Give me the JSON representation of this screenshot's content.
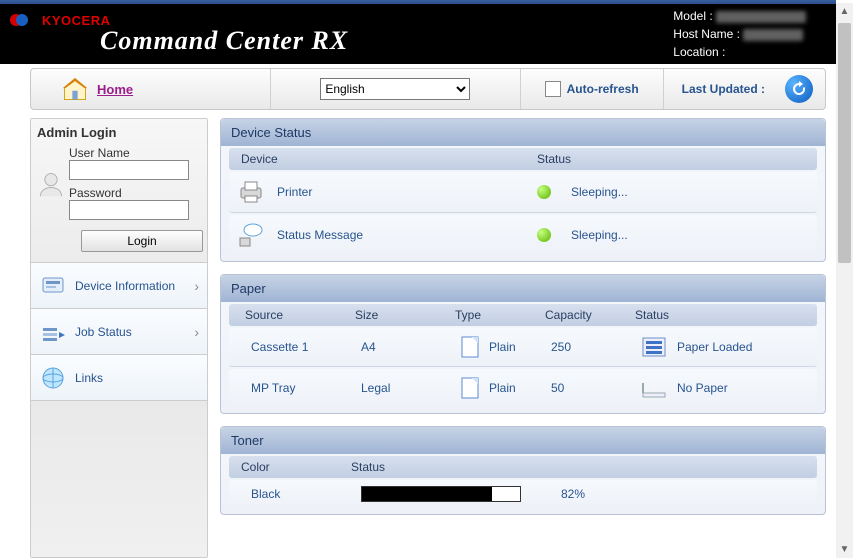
{
  "brand": {
    "vendor": "KYOCERA",
    "product": "Command Center",
    "suffix": "RX"
  },
  "host": {
    "model_label": "Model :",
    "model_value": "",
    "host_label": "Host Name :",
    "host_value": "",
    "location_label": "Location :"
  },
  "toolbar": {
    "home_label": "Home",
    "lang_value": "English",
    "auto_refresh": "Auto-refresh",
    "last_updated": "Last Updated :"
  },
  "login": {
    "title": "Admin Login",
    "user_label": "User Name",
    "pass_label": "Password",
    "button": "Login"
  },
  "nav": {
    "device_info": "Device Information",
    "job_status": "Job Status",
    "links": "Links"
  },
  "device_status": {
    "title": "Device Status",
    "head_device": "Device",
    "head_status": "Status",
    "rows": [
      {
        "name": "Printer",
        "status": "Sleeping..."
      },
      {
        "name": "Status Message",
        "status": "Sleeping..."
      }
    ]
  },
  "paper": {
    "title": "Paper",
    "head": {
      "source": "Source",
      "size": "Size",
      "type": "Type",
      "capacity": "Capacity",
      "status": "Status"
    },
    "rows": [
      {
        "source": "Cassette 1",
        "size": "A4",
        "type": "Plain",
        "capacity": "250",
        "status": "Paper Loaded",
        "loaded": true
      },
      {
        "source": "MP Tray",
        "size": "Legal",
        "type": "Plain",
        "capacity": "50",
        "status": "No Paper",
        "loaded": false
      }
    ]
  },
  "toner": {
    "title": "Toner",
    "head": {
      "color": "Color",
      "status": "Status"
    },
    "row": {
      "color": "Black",
      "percent_text": "82%",
      "percent": 82
    }
  }
}
